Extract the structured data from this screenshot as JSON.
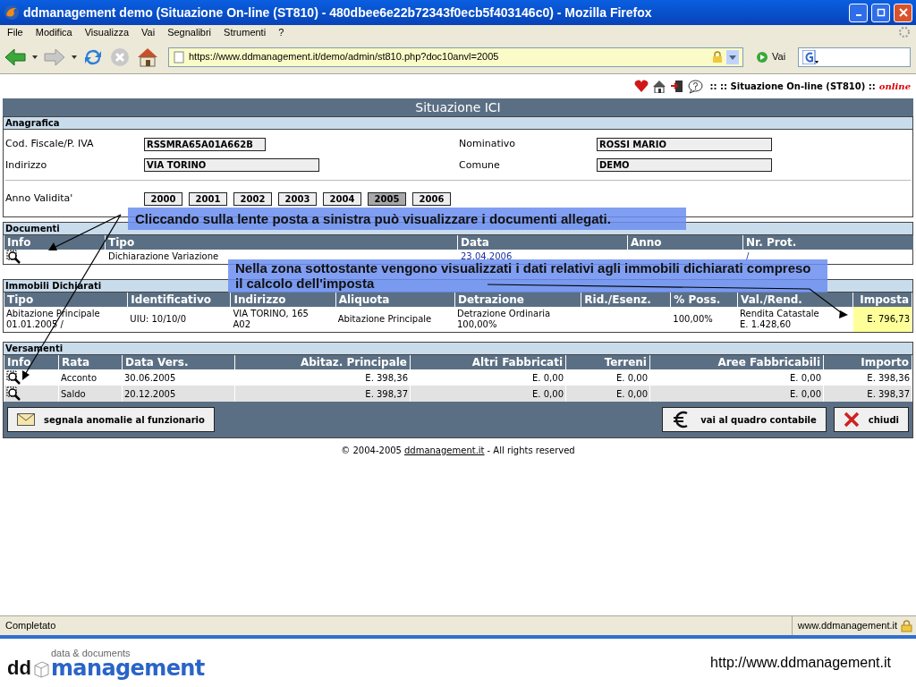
{
  "window": {
    "title": "ddmanagement demo (Situazione On-line (ST810) - 480dbee6e22b72343f0ecb5f403146c0) - Mozilla Firefox"
  },
  "menu": [
    "File",
    "Modifica",
    "Visualizza",
    "Vai",
    "Segnalibri",
    "Strumenti",
    "?"
  ],
  "toolbar": {
    "url": "https://www.ddmanagement.it/demo/admin/st810.php?doc10anvl=2005",
    "go": "Vai"
  },
  "header": {
    "breadcrumb": ":: :: Situazione On-line (ST810) ::",
    "status": "online"
  },
  "page_title": "Situazione ICI",
  "anagrafica": {
    "title": "Anagrafica",
    "fields": [
      {
        "label": "Cod. Fiscale/P. IVA",
        "value": "RSSMRA65A01A662B"
      },
      {
        "label": "Nominativo",
        "value": "ROSSI MARIO"
      },
      {
        "label": "Indirizzo",
        "value": "VIA TORINO"
      },
      {
        "label": "Comune",
        "value": "DEMO"
      }
    ],
    "anno_label": "Anno Validita'",
    "years": [
      {
        "label": "2000",
        "selected": false
      },
      {
        "label": "2001",
        "selected": false
      },
      {
        "label": "2002",
        "selected": false
      },
      {
        "label": "2003",
        "selected": false
      },
      {
        "label": "2004",
        "selected": false
      },
      {
        "label": "2005",
        "selected": true
      },
      {
        "label": "2006",
        "selected": false
      }
    ]
  },
  "documenti": {
    "title": "Documenti",
    "columns": [
      "Info",
      "Tipo",
      "Data",
      "Anno",
      "Nr. Prot."
    ],
    "rows": [
      {
        "tipo": "Dichiarazione Variazione",
        "data": "23.04.2006",
        "nr_prot": "/"
      }
    ]
  },
  "immobili": {
    "title": "Immobili Dichiarati",
    "columns": [
      "Tipo",
      "Identificativo",
      "Indirizzo",
      "Aliquota",
      "Detrazione",
      "Rid./Esenz.",
      "% Poss.",
      "Val./Rend.",
      "Imposta"
    ],
    "rows": [
      {
        "cells": [
          {
            "text": "Abitazione Principale\n01.01.2005 /",
            "highlighted": false
          },
          {
            "text": "UIU: 10/10/0",
            "highlighted": false
          },
          {
            "text": "VIA TORINO, 165\nA02",
            "highlighted": false
          },
          {
            "text": "Abitazione Principale",
            "highlighted": false
          },
          {
            "text": "Detrazione Ordinaria\n100,00%",
            "highlighted": false
          },
          {
            "text": "",
            "highlighted": false
          },
          {
            "text": "100,00%",
            "highlighted": false
          },
          {
            "text": "Rendita Catastale\nE. 1.428,60",
            "highlighted": false
          },
          {
            "text": "E. 796,73",
            "highlighted": true
          }
        ]
      }
    ]
  },
  "versamenti": {
    "title": "Versamenti",
    "columns": [
      "Info",
      "Rata",
      "Data Vers.",
      "Abitaz. Principale",
      "Altri Fabbricati",
      "Terreni",
      "Aree Fabbricabili",
      "Importo"
    ],
    "rows": [
      [
        "",
        "Acconto",
        "30.06.2005",
        "E. 398,36",
        "E. 0,00",
        "E. 0,00",
        "E. 0,00",
        "E. 398,36"
      ],
      [
        "",
        "Saldo",
        "20.12.2005",
        "E. 398,37",
        "E. 0,00",
        "E. 0,00",
        "E. 0,00",
        "E. 398,37"
      ]
    ]
  },
  "actions": [
    {
      "kind": "mail",
      "label": "segnala anomalie al funzionario"
    },
    {
      "kind": "euro",
      "label": "vai al quadro contabile"
    },
    {
      "kind": "close",
      "label": "chiudi"
    }
  ],
  "copyright": {
    "prefix": "© 2004-2005",
    "link": "ddmanagement.it",
    "suffix": "- All rights reserved"
  },
  "status_bar": {
    "text": "Completato",
    "domain": "www.ddmanagement.it"
  },
  "callouts": [
    "Cliccando sulla lente posta a sinistra può visualizzare i documenti allegati.",
    "Nella zona sottostante vengono visualizzati i dati relativi agli immobili dichiarati compreso il calcolo dell'imposta"
  ],
  "slide_footer": {
    "logo_dd": "dd",
    "logo_tagline": "data & documents",
    "logo_name": "management",
    "url": "http://www.ddmanagement.it"
  }
}
